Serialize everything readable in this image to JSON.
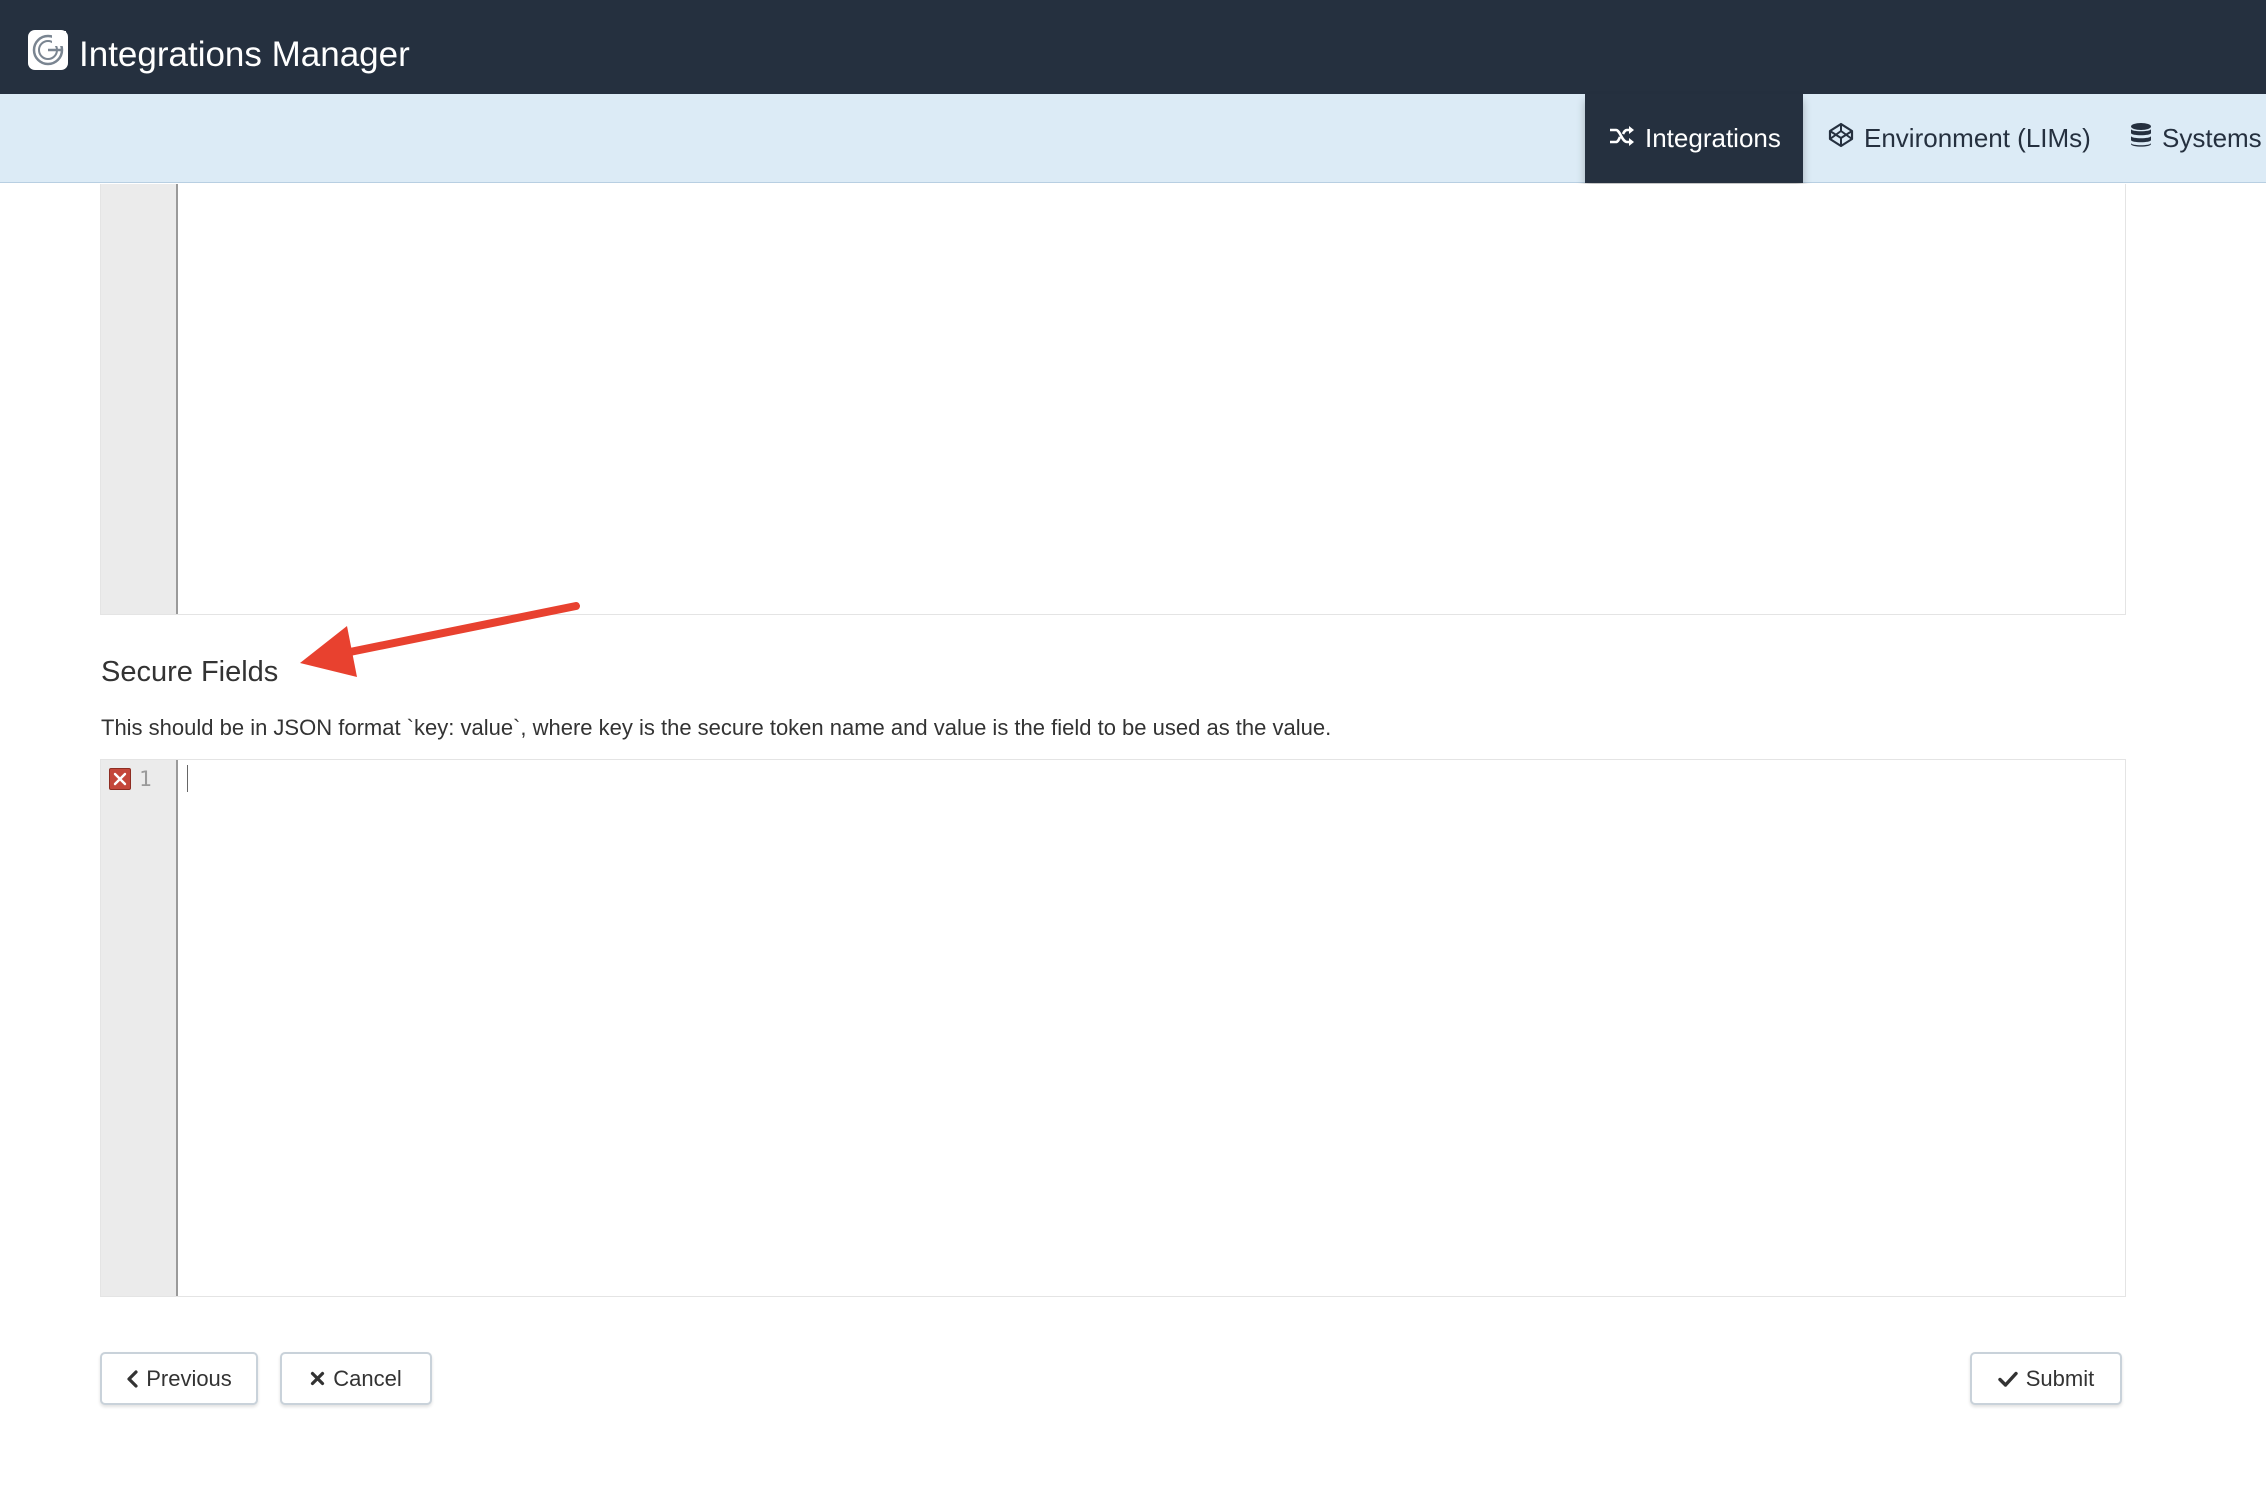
{
  "header": {
    "logo_icon": "g-logo-icon",
    "title": "Integrations Manager"
  },
  "nav": {
    "tabs": [
      {
        "label": "Integrations",
        "icon": "shuffle-icon",
        "active": true
      },
      {
        "label": "Environment (LIMs)",
        "icon": "codepen-icon",
        "active": false
      },
      {
        "label": "Systems",
        "icon": "database-icon",
        "active": false
      }
    ]
  },
  "secure_fields": {
    "title": "Secure Fields",
    "help": "This should be in JSON format `key: value`, where key is the secure token name and value is the field to be used as the value.",
    "editor": {
      "line_number": "1",
      "error_icon": "error-x-icon",
      "value": ""
    }
  },
  "buttons": {
    "previous_label": "Previous",
    "cancel_label": "Cancel",
    "submit_label": "Submit"
  },
  "colors": {
    "header_bg": "#25303f",
    "nav_bg": "#dcebf6",
    "annotation_arrow": "#e8412f",
    "error_marker": "#c4473a"
  }
}
